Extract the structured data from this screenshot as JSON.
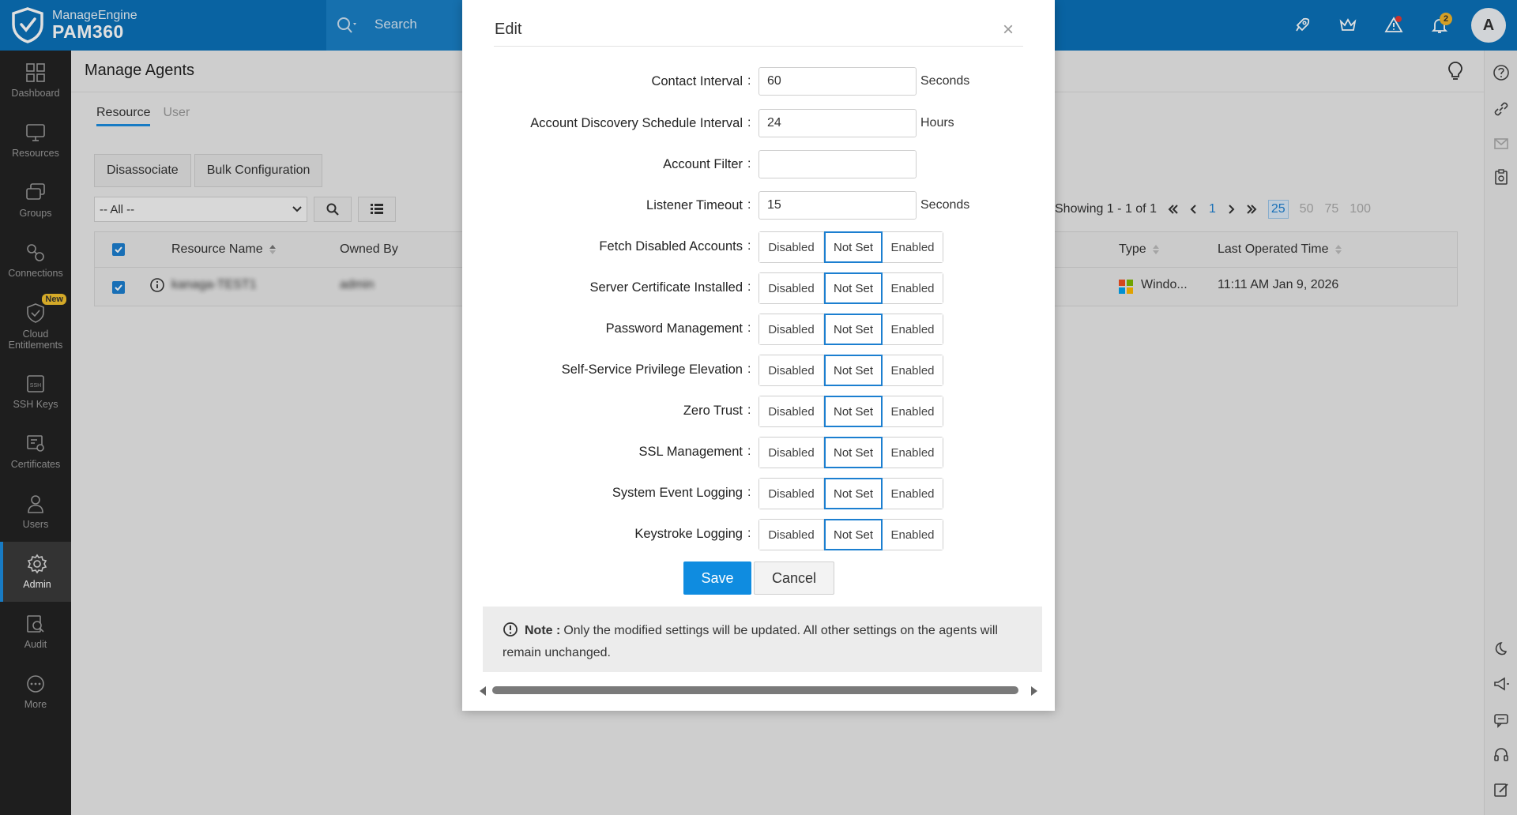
{
  "brand": {
    "vendor": "ManageEngine",
    "product": "PAM360"
  },
  "search": {
    "placeholder": "Search"
  },
  "topbar": {
    "notification_count": "2",
    "avatar_initial": "A"
  },
  "sidebar": {
    "items": [
      {
        "label": "Dashboard",
        "icon": "dashboard-icon"
      },
      {
        "label": "Resources",
        "icon": "monitor-icon"
      },
      {
        "label": "Groups",
        "icon": "groups-icon"
      },
      {
        "label": "Connections",
        "icon": "connections-icon"
      },
      {
        "label": "Cloud Entitlements",
        "icon": "cloud-shield-icon",
        "badge": "New"
      },
      {
        "label": "SSH Keys",
        "icon": "ssh-key-icon"
      },
      {
        "label": "Certificates",
        "icon": "certificate-icon"
      },
      {
        "label": "Users",
        "icon": "user-icon"
      },
      {
        "label": "Admin",
        "icon": "gear-icon",
        "active": true
      },
      {
        "label": "Audit",
        "icon": "audit-icon"
      },
      {
        "label": "More",
        "icon": "more-icon"
      }
    ]
  },
  "page": {
    "title": "Manage Agents",
    "tabs": [
      "Resource",
      "User"
    ],
    "active_tab": "Resource",
    "buttons": {
      "disassociate": "Disassociate",
      "bulk": "Bulk Configuration"
    },
    "filter": {
      "selected": "-- All --"
    },
    "pager": {
      "showing": "Showing 1 - 1 of 1",
      "page": "1",
      "sizes": [
        "25",
        "50",
        "75",
        "100"
      ],
      "active_size": "25"
    },
    "table": {
      "headers": {
        "resource_name": "Resource Name",
        "owned_by": "Owned By",
        "type": "Type",
        "last_operated": "Last Operated Time"
      },
      "rows": [
        {
          "resource_name": "kanaga-TEST1",
          "owned_by": "admin",
          "type": "Windo...",
          "last_operated": "11:11 AM Jan 9, 2026"
        }
      ]
    }
  },
  "modal": {
    "title": "Edit",
    "fields": {
      "contact_interval": {
        "label": "Contact Interval",
        "value": "60",
        "unit": "Seconds"
      },
      "discovery_interval": {
        "label": "Account Discovery Schedule Interval",
        "value": "24",
        "unit": "Hours"
      },
      "account_filter": {
        "label": "Account Filter",
        "value": ""
      },
      "listener_timeout": {
        "label": "Listener Timeout",
        "value": "15",
        "unit": "Seconds"
      }
    },
    "toggles": [
      {
        "label": "Fetch Disabled Accounts",
        "selected": "Not Set"
      },
      {
        "label": "Server Certificate Installed",
        "selected": "Not Set"
      },
      {
        "label": "Password Management",
        "selected": "Not Set"
      },
      {
        "label": "Self-Service Privilege Elevation",
        "selected": "Not Set"
      },
      {
        "label": "Zero Trust",
        "selected": "Not Set"
      },
      {
        "label": "SSL Management",
        "selected": "Not Set"
      },
      {
        "label": "System Event Logging",
        "selected": "Not Set"
      },
      {
        "label": "Keystroke Logging",
        "selected": "Not Set"
      }
    ],
    "options": {
      "disabled": "Disabled",
      "notset": "Not Set",
      "enabled": "Enabled"
    },
    "save_label": "Save",
    "cancel_label": "Cancel",
    "note": {
      "title": "Note :",
      "text": "Only the modified settings will be updated. All other settings on the agents will remain unchanged."
    }
  },
  "colors": {
    "topbar": "#0b71b9",
    "accent": "#1c7fd0",
    "primary_button": "#0f8ce0",
    "sidebar": "#232323"
  }
}
